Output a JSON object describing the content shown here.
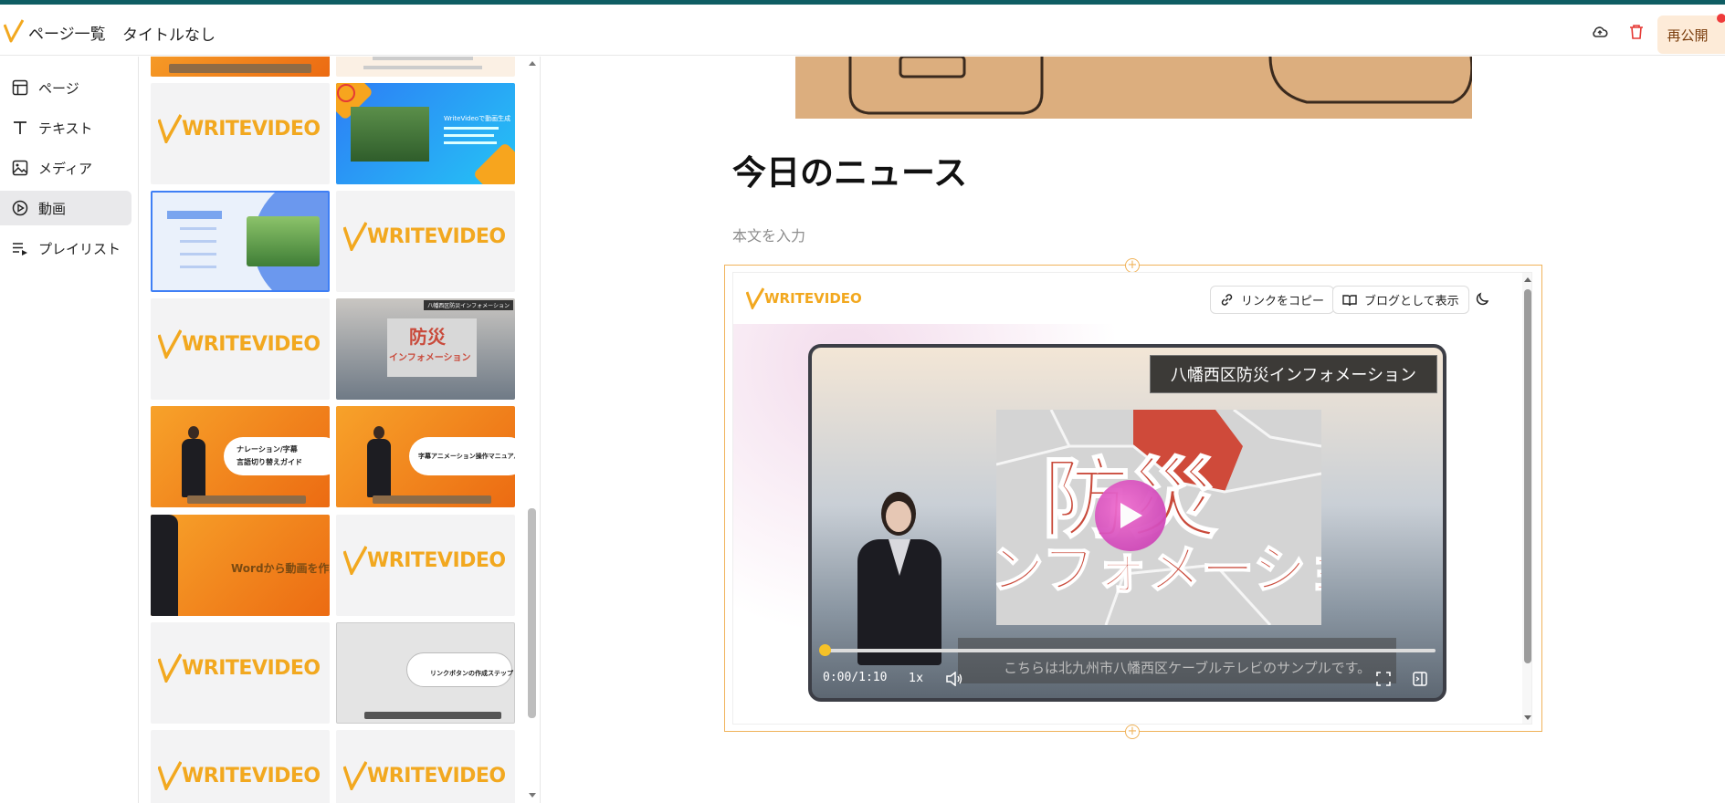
{
  "header": {
    "back_label": "ページ一覧",
    "page_title": "タイトルなし",
    "republish_label": "再公開"
  },
  "sidebar": {
    "items": [
      {
        "label": "ページ",
        "icon": "layout-icon"
      },
      {
        "label": "テキスト",
        "icon": "text-icon"
      },
      {
        "label": "メディア",
        "icon": "image-icon"
      },
      {
        "label": "動画",
        "icon": "play-circle-icon",
        "active": true
      },
      {
        "label": "プレイリスト",
        "icon": "playlist-icon"
      }
    ]
  },
  "thumbnails": {
    "logo_text": "WRITEVIDEO",
    "thumb_nature_title": "WriteVideoで動画生成",
    "thumb_bousai_label": "八幡西区防災インフォメーション",
    "thumb_bousai_big": "防災",
    "thumb_bousai_sub": "インフォメーション",
    "thumb_narration_title": "ナレーション/字幕",
    "thumb_narration_sub": "言語切り替えガイド",
    "thumb_subtitle_anim": "字幕アニメーション操作マニュアル",
    "thumb_word": "Wordから動画を作成",
    "thumb_link": "リンクボタンの作成ステップ"
  },
  "article": {
    "title": "今日のニュース",
    "body_placeholder": "本文を入力"
  },
  "embed": {
    "logo_text": "WRITEVIDEO",
    "copy_link_label": "リンクをコピー",
    "blog_view_label": "ブログとして表示",
    "video_title": "八幡西区防災インフォメーション",
    "map_big_text": "防災",
    "map_sub_text": "ンフォメーション",
    "subtitle": "こちらは北九州市八幡西区ケーブルテレビのサンプルです。",
    "time": "0:00/1:10",
    "rate": "1x",
    "progress": 0.01
  },
  "colors": {
    "accent_topbar": "#0f5d63",
    "brand_orange": "#f2a81f",
    "republish_bg": "#fdebd8",
    "active_nav_bg": "#e9e9eb"
  }
}
